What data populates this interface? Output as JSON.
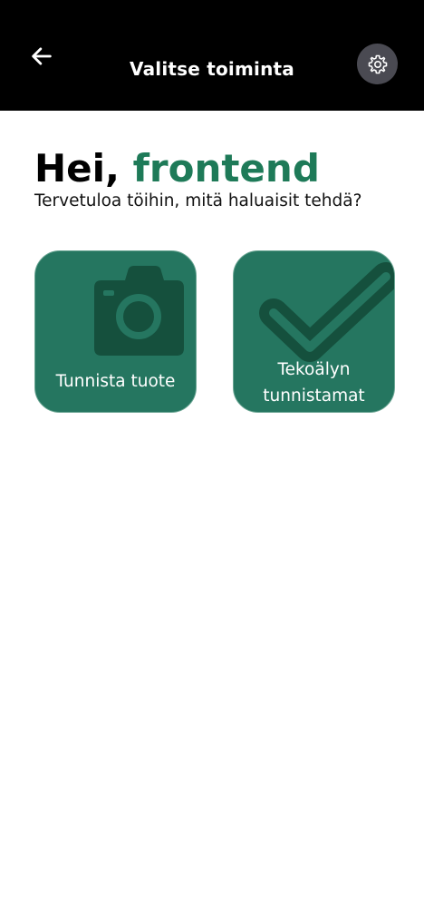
{
  "header": {
    "title": "Valitse toiminta",
    "back_icon": "arrow-left-icon",
    "settings_icon": "gear-icon",
    "background_color": "#000000"
  },
  "greeting": {
    "prefix": "Hei, ",
    "name": "frontend",
    "name_color": "#1e7a58"
  },
  "subtitle": "Tervetuloa töihin, mitä haluaisit tehdä?",
  "actions": [
    {
      "label": "Tunnista tuote",
      "icon": "camera-icon",
      "color": "#257660"
    },
    {
      "label_line1": "Tekoälyn",
      "label_line2": "tunnistamat",
      "icon": "checkmark-icon",
      "color": "#257660"
    }
  ]
}
